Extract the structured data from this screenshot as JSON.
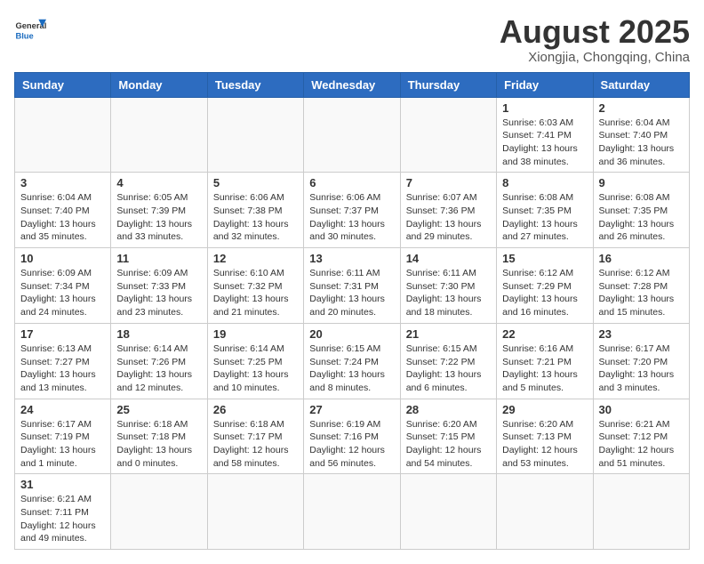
{
  "logo": {
    "text_general": "General",
    "text_blue": "Blue"
  },
  "header": {
    "month": "August 2025",
    "location": "Xiongjia, Chongqing, China"
  },
  "weekdays": [
    "Sunday",
    "Monday",
    "Tuesday",
    "Wednesday",
    "Thursday",
    "Friday",
    "Saturday"
  ],
  "weeks": [
    [
      {
        "day": "",
        "info": ""
      },
      {
        "day": "",
        "info": ""
      },
      {
        "day": "",
        "info": ""
      },
      {
        "day": "",
        "info": ""
      },
      {
        "day": "",
        "info": ""
      },
      {
        "day": "1",
        "info": "Sunrise: 6:03 AM\nSunset: 7:41 PM\nDaylight: 13 hours and 38 minutes."
      },
      {
        "day": "2",
        "info": "Sunrise: 6:04 AM\nSunset: 7:40 PM\nDaylight: 13 hours and 36 minutes."
      }
    ],
    [
      {
        "day": "3",
        "info": "Sunrise: 6:04 AM\nSunset: 7:40 PM\nDaylight: 13 hours and 35 minutes."
      },
      {
        "day": "4",
        "info": "Sunrise: 6:05 AM\nSunset: 7:39 PM\nDaylight: 13 hours and 33 minutes."
      },
      {
        "day": "5",
        "info": "Sunrise: 6:06 AM\nSunset: 7:38 PM\nDaylight: 13 hours and 32 minutes."
      },
      {
        "day": "6",
        "info": "Sunrise: 6:06 AM\nSunset: 7:37 PM\nDaylight: 13 hours and 30 minutes."
      },
      {
        "day": "7",
        "info": "Sunrise: 6:07 AM\nSunset: 7:36 PM\nDaylight: 13 hours and 29 minutes."
      },
      {
        "day": "8",
        "info": "Sunrise: 6:08 AM\nSunset: 7:35 PM\nDaylight: 13 hours and 27 minutes."
      },
      {
        "day": "9",
        "info": "Sunrise: 6:08 AM\nSunset: 7:35 PM\nDaylight: 13 hours and 26 minutes."
      }
    ],
    [
      {
        "day": "10",
        "info": "Sunrise: 6:09 AM\nSunset: 7:34 PM\nDaylight: 13 hours and 24 minutes."
      },
      {
        "day": "11",
        "info": "Sunrise: 6:09 AM\nSunset: 7:33 PM\nDaylight: 13 hours and 23 minutes."
      },
      {
        "day": "12",
        "info": "Sunrise: 6:10 AM\nSunset: 7:32 PM\nDaylight: 13 hours and 21 minutes."
      },
      {
        "day": "13",
        "info": "Sunrise: 6:11 AM\nSunset: 7:31 PM\nDaylight: 13 hours and 20 minutes."
      },
      {
        "day": "14",
        "info": "Sunrise: 6:11 AM\nSunset: 7:30 PM\nDaylight: 13 hours and 18 minutes."
      },
      {
        "day": "15",
        "info": "Sunrise: 6:12 AM\nSunset: 7:29 PM\nDaylight: 13 hours and 16 minutes."
      },
      {
        "day": "16",
        "info": "Sunrise: 6:12 AM\nSunset: 7:28 PM\nDaylight: 13 hours and 15 minutes."
      }
    ],
    [
      {
        "day": "17",
        "info": "Sunrise: 6:13 AM\nSunset: 7:27 PM\nDaylight: 13 hours and 13 minutes."
      },
      {
        "day": "18",
        "info": "Sunrise: 6:14 AM\nSunset: 7:26 PM\nDaylight: 13 hours and 12 minutes."
      },
      {
        "day": "19",
        "info": "Sunrise: 6:14 AM\nSunset: 7:25 PM\nDaylight: 13 hours and 10 minutes."
      },
      {
        "day": "20",
        "info": "Sunrise: 6:15 AM\nSunset: 7:24 PM\nDaylight: 13 hours and 8 minutes."
      },
      {
        "day": "21",
        "info": "Sunrise: 6:15 AM\nSunset: 7:22 PM\nDaylight: 13 hours and 6 minutes."
      },
      {
        "day": "22",
        "info": "Sunrise: 6:16 AM\nSunset: 7:21 PM\nDaylight: 13 hours and 5 minutes."
      },
      {
        "day": "23",
        "info": "Sunrise: 6:17 AM\nSunset: 7:20 PM\nDaylight: 13 hours and 3 minutes."
      }
    ],
    [
      {
        "day": "24",
        "info": "Sunrise: 6:17 AM\nSunset: 7:19 PM\nDaylight: 13 hours and 1 minute."
      },
      {
        "day": "25",
        "info": "Sunrise: 6:18 AM\nSunset: 7:18 PM\nDaylight: 13 hours and 0 minutes."
      },
      {
        "day": "26",
        "info": "Sunrise: 6:18 AM\nSunset: 7:17 PM\nDaylight: 12 hours and 58 minutes."
      },
      {
        "day": "27",
        "info": "Sunrise: 6:19 AM\nSunset: 7:16 PM\nDaylight: 12 hours and 56 minutes."
      },
      {
        "day": "28",
        "info": "Sunrise: 6:20 AM\nSunset: 7:15 PM\nDaylight: 12 hours and 54 minutes."
      },
      {
        "day": "29",
        "info": "Sunrise: 6:20 AM\nSunset: 7:13 PM\nDaylight: 12 hours and 53 minutes."
      },
      {
        "day": "30",
        "info": "Sunrise: 6:21 AM\nSunset: 7:12 PM\nDaylight: 12 hours and 51 minutes."
      }
    ],
    [
      {
        "day": "31",
        "info": "Sunrise: 6:21 AM\nSunset: 7:11 PM\nDaylight: 12 hours and 49 minutes."
      },
      {
        "day": "",
        "info": ""
      },
      {
        "day": "",
        "info": ""
      },
      {
        "day": "",
        "info": ""
      },
      {
        "day": "",
        "info": ""
      },
      {
        "day": "",
        "info": ""
      },
      {
        "day": "",
        "info": ""
      }
    ]
  ]
}
